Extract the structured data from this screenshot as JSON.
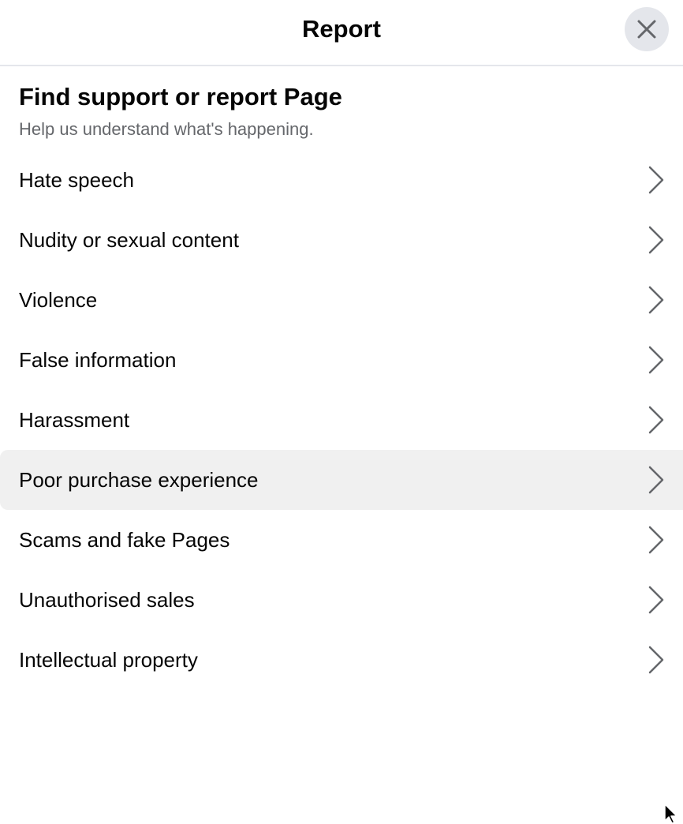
{
  "header": {
    "title": "Report",
    "close_icon": "close-icon"
  },
  "intro": {
    "title": "Find support or report Page",
    "subtitle": "Help us understand what's happening."
  },
  "options": [
    {
      "label": "Hate speech",
      "icon": "chevron-right-icon",
      "hovered": false
    },
    {
      "label": "Nudity or sexual content",
      "icon": "chevron-right-icon",
      "hovered": false
    },
    {
      "label": "Violence",
      "icon": "chevron-right-icon",
      "hovered": false
    },
    {
      "label": "False information",
      "icon": "chevron-right-icon",
      "hovered": false
    },
    {
      "label": "Harassment",
      "icon": "chevron-right-icon",
      "hovered": false
    },
    {
      "label": "Poor purchase experience",
      "icon": "chevron-right-icon",
      "hovered": true
    },
    {
      "label": "Scams and fake Pages",
      "icon": "chevron-right-icon",
      "hovered": false
    },
    {
      "label": "Unauthorised sales",
      "icon": "chevron-right-icon",
      "hovered": false
    },
    {
      "label": "Intellectual property",
      "icon": "chevron-right-icon",
      "hovered": false
    }
  ],
  "colors": {
    "text_primary": "#050505",
    "text_secondary": "#65676b",
    "close_button_bg": "#e4e6eb",
    "hover_bg": "#f0f0f0",
    "chevron": "#65676b"
  }
}
